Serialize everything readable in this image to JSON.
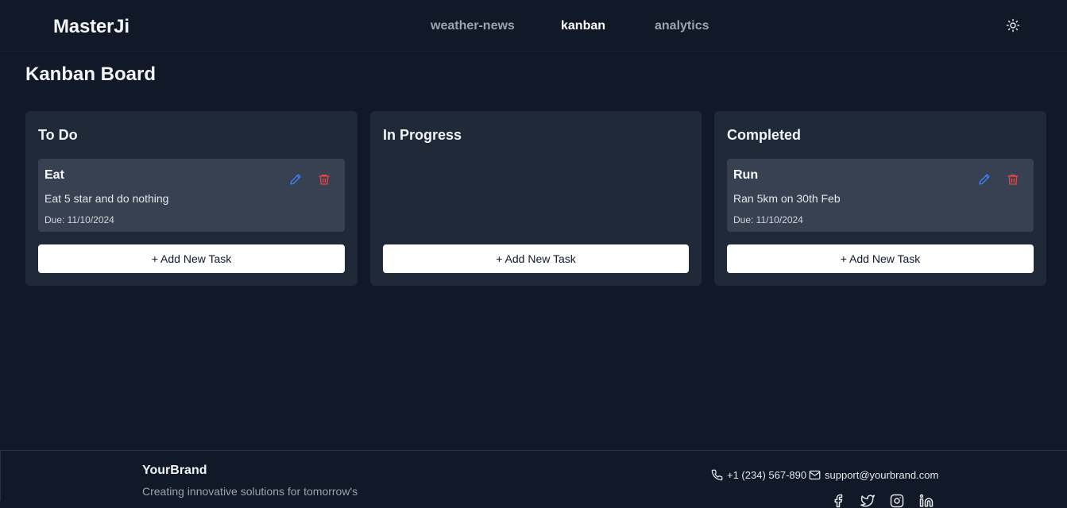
{
  "header": {
    "brand": "MasterJi",
    "nav": [
      {
        "label": "weather-news",
        "active": false
      },
      {
        "label": "kanban",
        "active": true
      },
      {
        "label": "analytics",
        "active": false
      }
    ],
    "theme_icon": "sun-icon"
  },
  "page": {
    "title": "Kanban Board"
  },
  "columns": [
    {
      "title": "To Do",
      "tasks": [
        {
          "title": "Eat",
          "description": "Eat 5 star and do nothing",
          "due": "Due: 11/10/2024"
        }
      ],
      "add_label": "+ Add New Task"
    },
    {
      "title": "In Progress",
      "tasks": [],
      "add_label": "+ Add New Task"
    },
    {
      "title": "Completed",
      "tasks": [
        {
          "title": "Run",
          "description": "Ran 5km on 30th Feb",
          "due": "Due: 11/10/2024"
        }
      ],
      "add_label": "+ Add New Task"
    }
  ],
  "footer": {
    "brand": "YourBrand",
    "tagline": "Creating innovative solutions for tomorrow's",
    "phone": "+1 (234) 567-890",
    "email": "support@yourbrand.com",
    "social": [
      "facebook-icon",
      "twitter-icon",
      "instagram-icon",
      "linkedin-icon"
    ]
  },
  "colors": {
    "background": "#111827",
    "column": "#1f2937",
    "card": "#374151",
    "edit_accent": "#3b82f6",
    "delete_accent": "#ef4444"
  }
}
